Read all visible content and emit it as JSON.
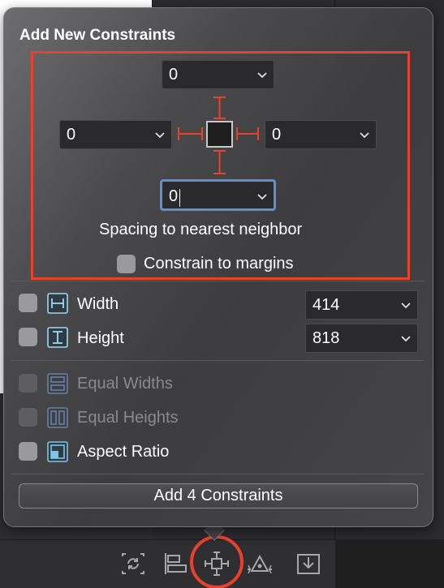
{
  "popover": {
    "title": "Add New Constraints",
    "spacing": {
      "top": "0",
      "left": "0",
      "right": "0",
      "bottom": "0",
      "caption": "Spacing to nearest neighbor",
      "constrain_margins_label": "Constrain to margins"
    },
    "size": {
      "width_label": "Width",
      "width_value": "414",
      "height_label": "Height",
      "height_value": "818"
    },
    "relations": {
      "equal_widths": "Equal Widths",
      "equal_heights": "Equal Heights",
      "aspect_ratio": "Aspect Ratio"
    },
    "add_button_label": "Add 4 Constraints"
  },
  "toolbar": {
    "icons": [
      "update-frames-icon",
      "align-icon",
      "add-constraints-icon",
      "resolve-issues-icon",
      "embed-in-icon"
    ]
  },
  "colors": {
    "highlight": "#e8412c",
    "strut": "#e8412c",
    "focus": "#5c8fd6",
    "icon_accent": "#7fc3e6"
  }
}
